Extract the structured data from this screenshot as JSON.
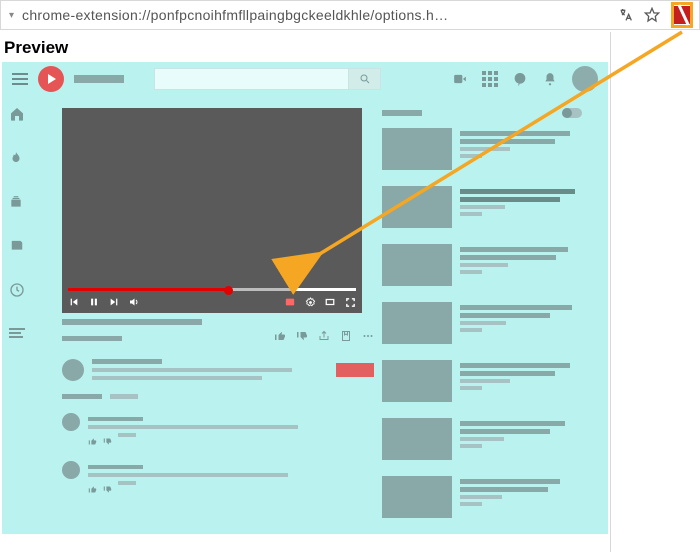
{
  "address_bar": {
    "url": "chrome-extension://ponfpcnoihfmfllpaingbgckeeldkhle/options.html"
  },
  "page": {
    "preview_label": "Preview"
  },
  "icons": {
    "translate": "translate-icon",
    "star": "star-icon",
    "extension": "extension-icon"
  },
  "colors": {
    "frame_bg": "#b9f2ef",
    "player": "#5a5a5a",
    "progress": "#e20000",
    "highlight": "#f5a623"
  }
}
